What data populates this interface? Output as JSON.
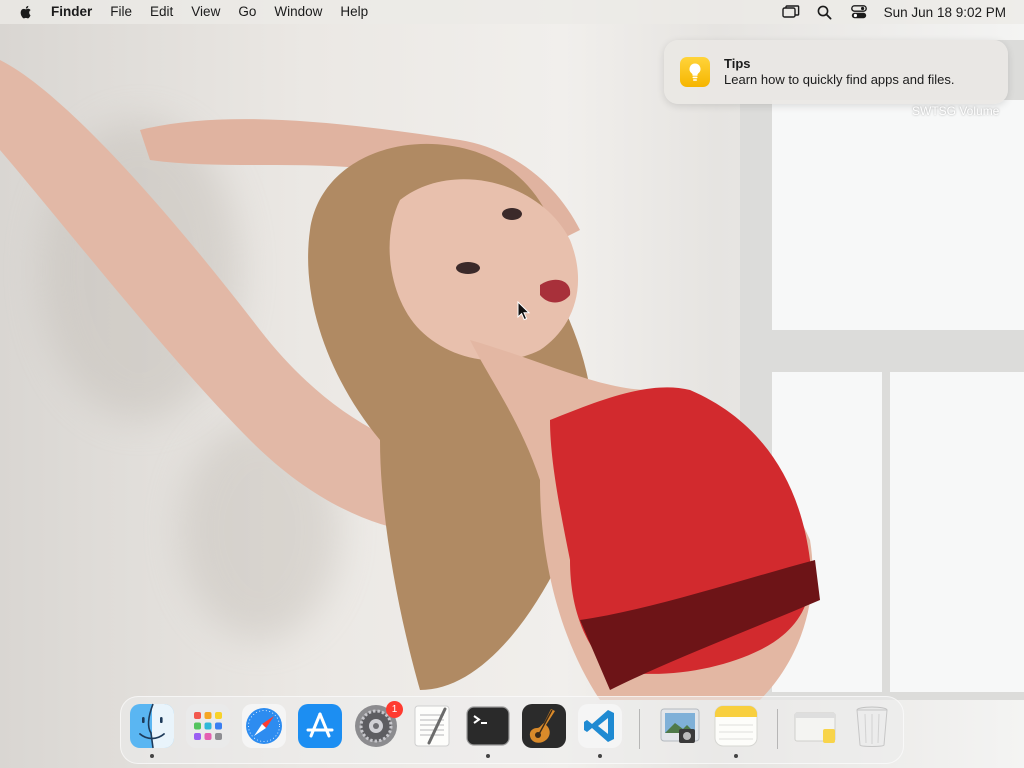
{
  "menubar": {
    "apple_icon": "apple-logo-icon",
    "app_name": "Finder",
    "menus": [
      "File",
      "Edit",
      "View",
      "Go",
      "Window",
      "Help"
    ],
    "status_icons": [
      "screen-mirroring-icon",
      "spotlight-search-icon",
      "control-center-icon"
    ],
    "clock": "Sun Jun 18  9:02 PM"
  },
  "notification": {
    "app_icon": "tips-lightbulb-icon",
    "title": "Tips",
    "body": "Learn how to quickly find apps and files."
  },
  "desktop": {
    "volume_label": "SWTSG Volume"
  },
  "dock": {
    "apps": [
      {
        "name": "Finder",
        "icon": "finder-icon",
        "running": true
      },
      {
        "name": "Launchpad",
        "icon": "launchpad-icon",
        "running": false
      },
      {
        "name": "Safari",
        "icon": "safari-icon",
        "running": false
      },
      {
        "name": "App Store",
        "icon": "app-store-icon",
        "running": false
      },
      {
        "name": "System Settings",
        "icon": "system-settings-icon",
        "running": false,
        "badge": "1"
      },
      {
        "name": "TextEdit",
        "icon": "textedit-icon",
        "running": false
      },
      {
        "name": "Terminal",
        "icon": "terminal-icon",
        "running": true
      },
      {
        "name": "GarageBand",
        "icon": "garageband-icon",
        "running": false
      },
      {
        "name": "Visual Studio Code",
        "icon": "vscode-icon",
        "running": true
      }
    ],
    "recent": [
      {
        "name": "Preview",
        "icon": "preview-icon",
        "running": false
      },
      {
        "name": "Notes",
        "icon": "notes-icon",
        "running": true
      }
    ],
    "stack": [
      {
        "name": "Downloads",
        "icon": "downloads-stack-icon"
      },
      {
        "name": "Trash",
        "icon": "trash-icon"
      }
    ]
  },
  "colors": {
    "menubar_bg": "#eceae7",
    "notification_bg": "#e9e7e4",
    "badge": "#ff3b30",
    "tips_yellow": "#f6b500"
  }
}
